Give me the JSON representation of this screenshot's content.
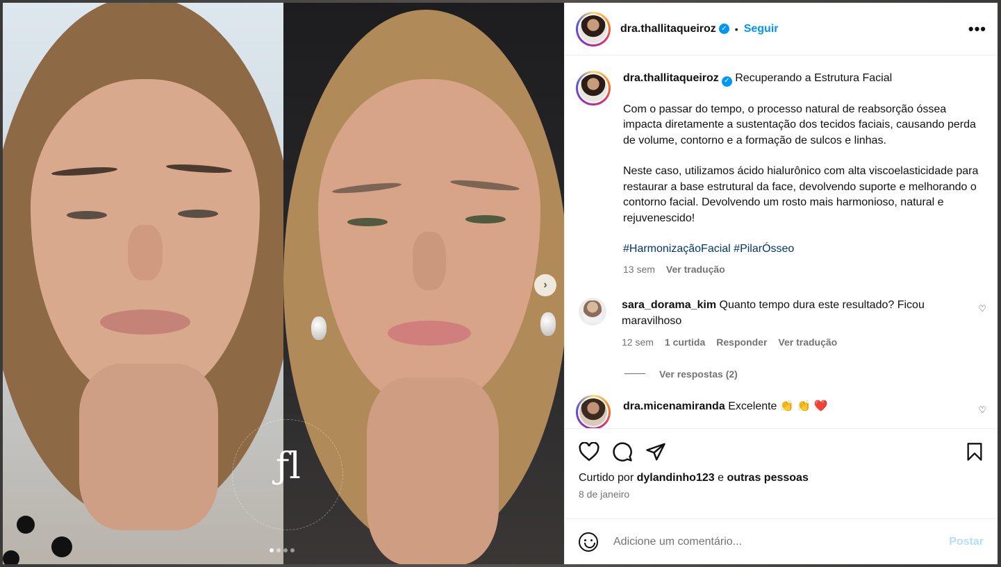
{
  "post": {
    "username": "dra.thallitaqueiroz",
    "follow_label": "Seguir",
    "bullet": "•",
    "more_label": "•••"
  },
  "caption": {
    "username": "dra.thallitaqueiroz",
    "title": "Recuperando a Estrutura Facial",
    "paragraph1": "Com o passar do tempo, o processo natural de reabsorção óssea impacta diretamente a sustentação dos tecidos faciais, causando perda de volume, contorno e a formação de sulcos e linhas.",
    "paragraph2": "Neste caso, utilizamos ácido hialurônico com alta viscoelasticidade para restaurar a base estrutural da face, devolvendo suporte e melhorando o contorno facial. Devolvendo um rosto mais harmonioso, natural e rejuvenescido!",
    "hashtags": "#HarmonizaçãoFacial #PilarÓsseo",
    "time": "13 sem",
    "translate": "Ver tradução"
  },
  "comments": [
    {
      "username": "sara_dorama_kim",
      "text": "Quanto tempo dura este resultado? Ficou maravilhoso",
      "time": "12 sem",
      "likes": "1 curtida",
      "reply": "Responder",
      "translate": "Ver tradução",
      "view_replies": "Ver respostas (2)"
    },
    {
      "username": "dra.micenamiranda",
      "text": "Excelente 👏 👏 ❤️"
    }
  ],
  "engagement": {
    "liked_by_prefix": "Curtido por",
    "liked_by_user": "dylandinho123",
    "liked_by_conj": "e",
    "liked_by_others": "outras pessoas",
    "date": "8 de janeiro"
  },
  "comment_box": {
    "placeholder": "Adicione um comentário...",
    "post_label": "Postar"
  },
  "carousel": {
    "total_slides": 4,
    "current_slide": 1
  },
  "colors": {
    "accent": "#0095f6",
    "hashtag": "#00376b",
    "muted": "#737373",
    "post_disabled": "#b2dffc"
  }
}
